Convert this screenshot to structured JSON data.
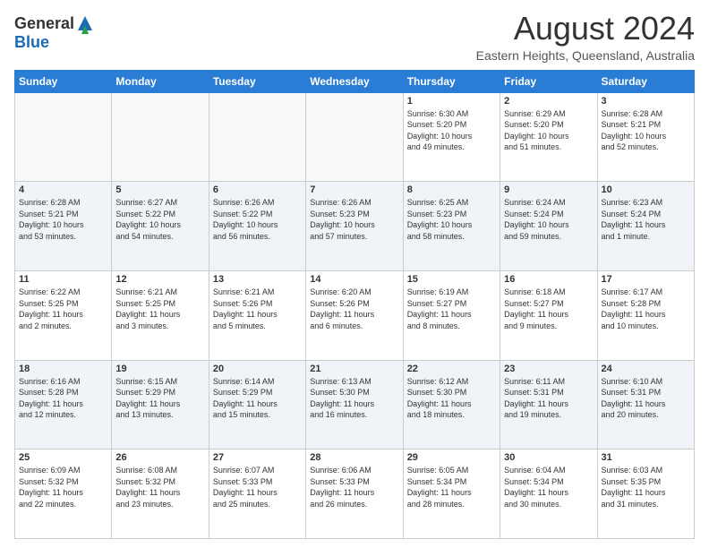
{
  "header": {
    "logo_general": "General",
    "logo_blue": "Blue",
    "main_title": "August 2024",
    "subtitle": "Eastern Heights, Queensland, Australia"
  },
  "calendar": {
    "days_of_week": [
      "Sunday",
      "Monday",
      "Tuesday",
      "Wednesday",
      "Thursday",
      "Friday",
      "Saturday"
    ],
    "weeks": [
      [
        {
          "day": "",
          "info": ""
        },
        {
          "day": "",
          "info": ""
        },
        {
          "day": "",
          "info": ""
        },
        {
          "day": "",
          "info": ""
        },
        {
          "day": "1",
          "info": "Sunrise: 6:30 AM\nSunset: 5:20 PM\nDaylight: 10 hours\nand 49 minutes."
        },
        {
          "day": "2",
          "info": "Sunrise: 6:29 AM\nSunset: 5:20 PM\nDaylight: 10 hours\nand 51 minutes."
        },
        {
          "day": "3",
          "info": "Sunrise: 6:28 AM\nSunset: 5:21 PM\nDaylight: 10 hours\nand 52 minutes."
        }
      ],
      [
        {
          "day": "4",
          "info": "Sunrise: 6:28 AM\nSunset: 5:21 PM\nDaylight: 10 hours\nand 53 minutes."
        },
        {
          "day": "5",
          "info": "Sunrise: 6:27 AM\nSunset: 5:22 PM\nDaylight: 10 hours\nand 54 minutes."
        },
        {
          "day": "6",
          "info": "Sunrise: 6:26 AM\nSunset: 5:22 PM\nDaylight: 10 hours\nand 56 minutes."
        },
        {
          "day": "7",
          "info": "Sunrise: 6:26 AM\nSunset: 5:23 PM\nDaylight: 10 hours\nand 57 minutes."
        },
        {
          "day": "8",
          "info": "Sunrise: 6:25 AM\nSunset: 5:23 PM\nDaylight: 10 hours\nand 58 minutes."
        },
        {
          "day": "9",
          "info": "Sunrise: 6:24 AM\nSunset: 5:24 PM\nDaylight: 10 hours\nand 59 minutes."
        },
        {
          "day": "10",
          "info": "Sunrise: 6:23 AM\nSunset: 5:24 PM\nDaylight: 11 hours\nand 1 minute."
        }
      ],
      [
        {
          "day": "11",
          "info": "Sunrise: 6:22 AM\nSunset: 5:25 PM\nDaylight: 11 hours\nand 2 minutes."
        },
        {
          "day": "12",
          "info": "Sunrise: 6:21 AM\nSunset: 5:25 PM\nDaylight: 11 hours\nand 3 minutes."
        },
        {
          "day": "13",
          "info": "Sunrise: 6:21 AM\nSunset: 5:26 PM\nDaylight: 11 hours\nand 5 minutes."
        },
        {
          "day": "14",
          "info": "Sunrise: 6:20 AM\nSunset: 5:26 PM\nDaylight: 11 hours\nand 6 minutes."
        },
        {
          "day": "15",
          "info": "Sunrise: 6:19 AM\nSunset: 5:27 PM\nDaylight: 11 hours\nand 8 minutes."
        },
        {
          "day": "16",
          "info": "Sunrise: 6:18 AM\nSunset: 5:27 PM\nDaylight: 11 hours\nand 9 minutes."
        },
        {
          "day": "17",
          "info": "Sunrise: 6:17 AM\nSunset: 5:28 PM\nDaylight: 11 hours\nand 10 minutes."
        }
      ],
      [
        {
          "day": "18",
          "info": "Sunrise: 6:16 AM\nSunset: 5:28 PM\nDaylight: 11 hours\nand 12 minutes."
        },
        {
          "day": "19",
          "info": "Sunrise: 6:15 AM\nSunset: 5:29 PM\nDaylight: 11 hours\nand 13 minutes."
        },
        {
          "day": "20",
          "info": "Sunrise: 6:14 AM\nSunset: 5:29 PM\nDaylight: 11 hours\nand 15 minutes."
        },
        {
          "day": "21",
          "info": "Sunrise: 6:13 AM\nSunset: 5:30 PM\nDaylight: 11 hours\nand 16 minutes."
        },
        {
          "day": "22",
          "info": "Sunrise: 6:12 AM\nSunset: 5:30 PM\nDaylight: 11 hours\nand 18 minutes."
        },
        {
          "day": "23",
          "info": "Sunrise: 6:11 AM\nSunset: 5:31 PM\nDaylight: 11 hours\nand 19 minutes."
        },
        {
          "day": "24",
          "info": "Sunrise: 6:10 AM\nSunset: 5:31 PM\nDaylight: 11 hours\nand 20 minutes."
        }
      ],
      [
        {
          "day": "25",
          "info": "Sunrise: 6:09 AM\nSunset: 5:32 PM\nDaylight: 11 hours\nand 22 minutes."
        },
        {
          "day": "26",
          "info": "Sunrise: 6:08 AM\nSunset: 5:32 PM\nDaylight: 11 hours\nand 23 minutes."
        },
        {
          "day": "27",
          "info": "Sunrise: 6:07 AM\nSunset: 5:33 PM\nDaylight: 11 hours\nand 25 minutes."
        },
        {
          "day": "28",
          "info": "Sunrise: 6:06 AM\nSunset: 5:33 PM\nDaylight: 11 hours\nand 26 minutes."
        },
        {
          "day": "29",
          "info": "Sunrise: 6:05 AM\nSunset: 5:34 PM\nDaylight: 11 hours\nand 28 minutes."
        },
        {
          "day": "30",
          "info": "Sunrise: 6:04 AM\nSunset: 5:34 PM\nDaylight: 11 hours\nand 30 minutes."
        },
        {
          "day": "31",
          "info": "Sunrise: 6:03 AM\nSunset: 5:35 PM\nDaylight: 11 hours\nand 31 minutes."
        }
      ]
    ]
  }
}
